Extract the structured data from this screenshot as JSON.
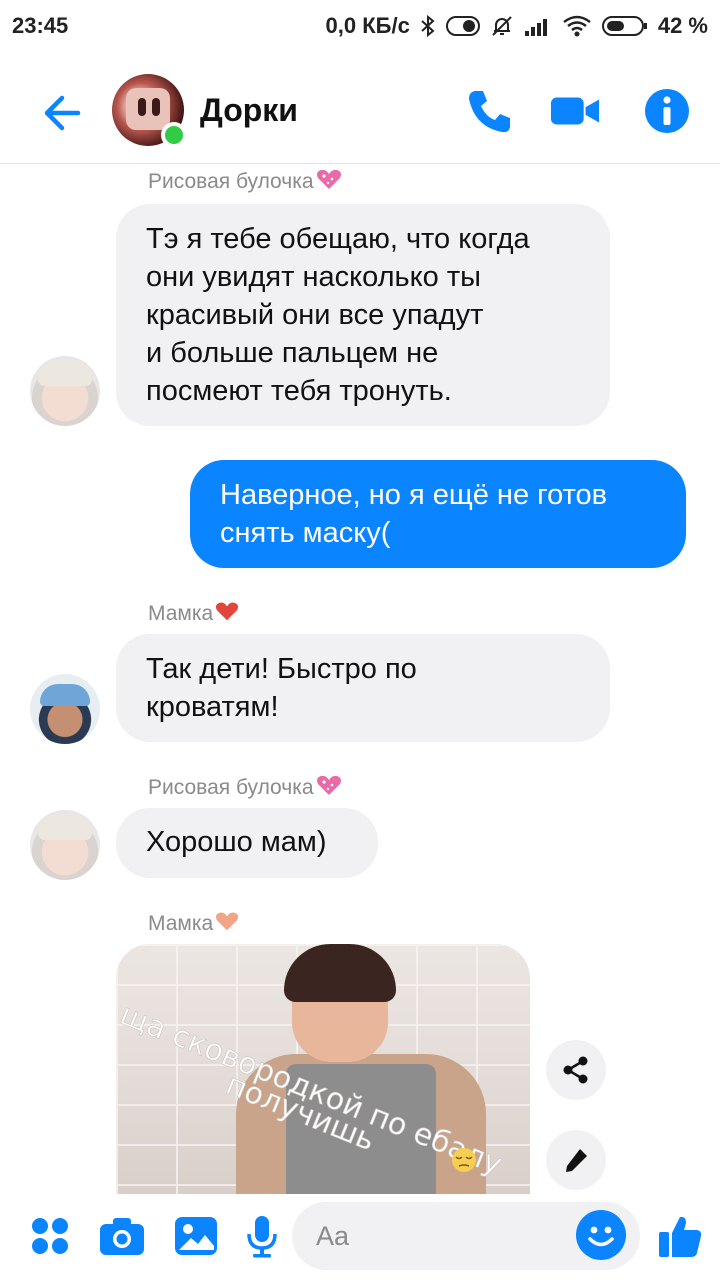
{
  "status_bar": {
    "time": "23:45",
    "network_speed": "0,0 КБ/с",
    "battery": "42 %"
  },
  "header": {
    "contact_name": "Дорки",
    "online": true,
    "accent_color": "#0a84ff"
  },
  "messages": [
    {
      "direction": "incoming",
      "sender": "Рисовая булочка",
      "sender_emoji": "sparkling-heart-icon",
      "text": "Тэ я тебе обещаю, что когда они увидят насколько ты красивый они все упадут и больше пальцем не посмеют тебя тронуть.",
      "lines": [
        "Тэ я тебе обещаю, что когда",
        "они увидят насколько ты",
        "красивый они все упадут",
        "и больше пальцем не",
        "посмеют тебя тронуть."
      ]
    },
    {
      "direction": "outgoing",
      "text": "Наверное, но я ещё не готов снять маску(",
      "lines": [
        "Наверное, но я ещё не готов",
        "снять маску("
      ]
    },
    {
      "direction": "incoming",
      "sender": "Мамка",
      "sender_emoji": "red-heart-icon",
      "text": "Так дети! Быстро по кроватям!",
      "lines": [
        "Так дети! Быстро по",
        "кроватям!"
      ]
    },
    {
      "direction": "incoming",
      "sender": "Рисовая булочка",
      "sender_emoji": "sparkling-heart-icon",
      "text": "Хорошо мам)",
      "lines": [
        "Хорошо мам)"
      ]
    },
    {
      "direction": "incoming",
      "sender": "Мамка",
      "sender_emoji": "peach-heart-icon",
      "type": "image",
      "image_caption_line1": "ща сковородкой по ебалу",
      "image_caption_line2": "получишь"
    }
  ],
  "composer": {
    "placeholder": "Aa"
  }
}
